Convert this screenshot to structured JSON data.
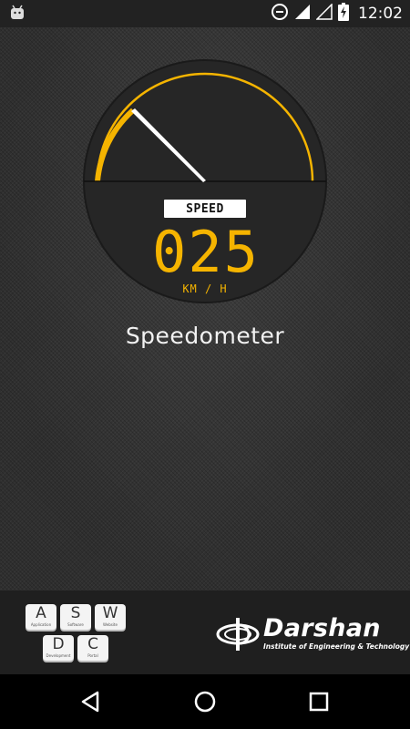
{
  "status_bar": {
    "time": "12:02",
    "icons": [
      "android-icon",
      "data-saver-icon",
      "signal-icon",
      "signal-empty-icon",
      "battery-charging-icon"
    ]
  },
  "speedometer": {
    "label": "SPEED",
    "speed_display": "025",
    "unit": "KM / H",
    "title": "Speedometer",
    "accent_color": "#f5b400"
  },
  "footer": {
    "keys": [
      {
        "key": "A",
        "sub": "Application"
      },
      {
        "key": "S",
        "sub": "Software"
      },
      {
        "key": "W",
        "sub": "Website"
      },
      {
        "key": "D",
        "sub": "Development"
      },
      {
        "key": "C",
        "sub": "Portal"
      }
    ],
    "logo": {
      "name": "Darshan",
      "subtitle": "Institute of Engineering & Technology"
    }
  },
  "nav_bar": {
    "icons": [
      "back-icon",
      "home-icon",
      "recents-icon"
    ]
  }
}
